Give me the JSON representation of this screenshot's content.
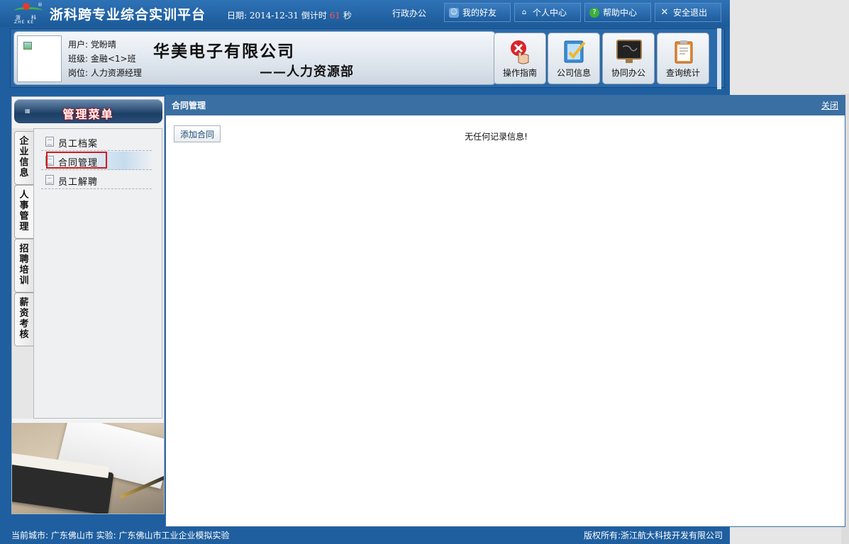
{
  "topbar": {
    "logo_text_left": "浙",
    "logo_text_right": "科",
    "logo_text_latin": "ZHE  KE",
    "platform_title": "浙科跨专业综合实训平台",
    "date_label": "日期:",
    "date_value": "2014-12-31",
    "countdown_label": "倒计时",
    "countdown_value": "61",
    "countdown_unit": "秒",
    "admin_office": "行政办公",
    "buttons": [
      {
        "label": "我的好友",
        "icon": "friends-icon"
      },
      {
        "label": "个人中心",
        "icon": "home-icon"
      },
      {
        "label": "帮助中心",
        "icon": "help-icon"
      },
      {
        "label": "安全退出",
        "icon": "close-icon"
      }
    ]
  },
  "user": {
    "name_line": "用户: 党盼晴",
    "class_line": "班级: 金融<1>班",
    "post_line": "岗位: 人力资源经理"
  },
  "company": {
    "name": "华美电子有限公司",
    "department": "——人力资源部"
  },
  "tiles": [
    {
      "label": "操作指南",
      "icon": "guide-hand-icon"
    },
    {
      "label": "公司信息",
      "icon": "company-info-icon"
    },
    {
      "label": "协同办公",
      "icon": "collaboration-icon"
    },
    {
      "label": "查询统计",
      "icon": "statistics-clipboard-icon"
    }
  ],
  "sidebar": {
    "menu_title": "管理菜单",
    "vtabs": [
      "企业信息",
      "人事管理",
      "招聘培训",
      "薪资考核"
    ],
    "active_vtab": "人事管理",
    "items": [
      "员工档案",
      "合同管理",
      "员工解聘"
    ],
    "selected_item": "合同管理"
  },
  "content": {
    "title": "合同管理",
    "close_label": "关闭",
    "add_button_label": "添加合同",
    "empty_message": "无任何记录信息!"
  },
  "footer": {
    "left": "当前城市: 广东佛山市   实验: 广东佛山市工业企业模拟实验",
    "right": "版权所有:浙江航大科技开发有限公司"
  },
  "colors": {
    "frame_blue": "#1f5fa0",
    "title_bar_blue": "#3a6fa3",
    "selection_red": "#d41a1a",
    "countdown_red": "#ff5252"
  }
}
